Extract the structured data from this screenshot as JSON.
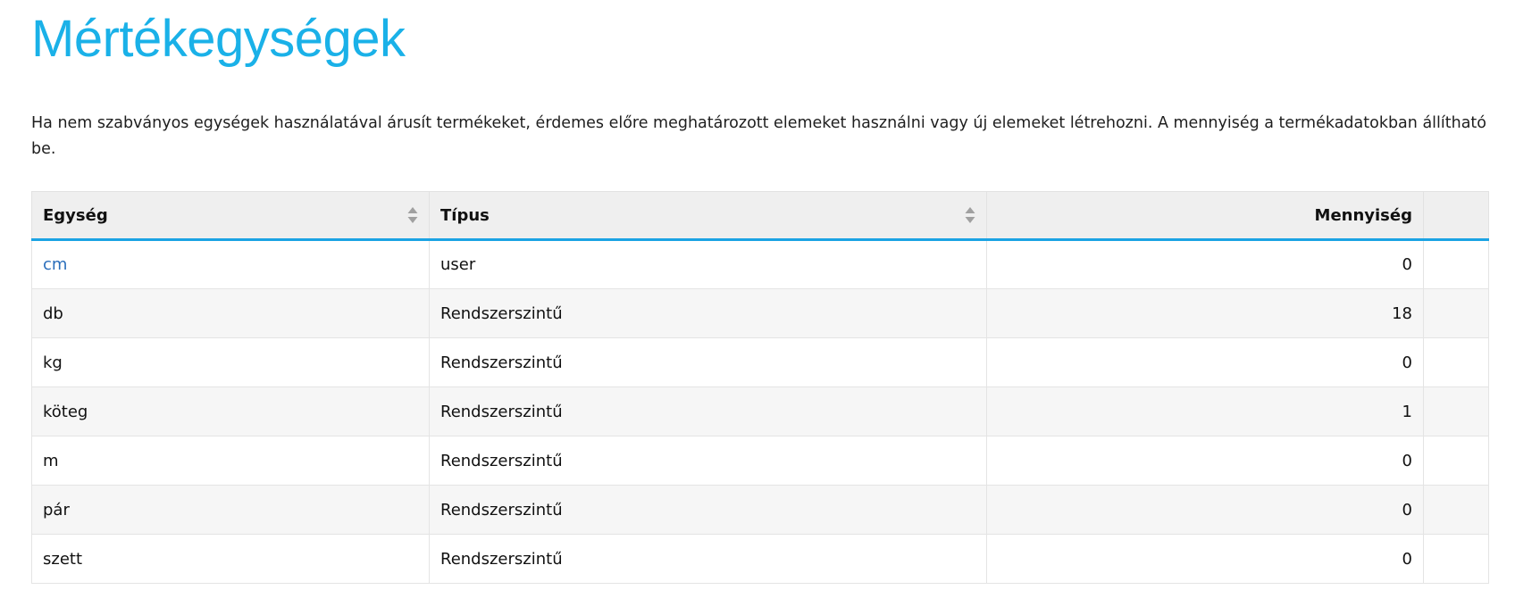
{
  "page": {
    "title": "Mértékegységek",
    "description": "Ha nem szabványos egységek használatával árusít termékeket, érdemes előre meghatározott elemeket használni vagy új elemeket létrehozni. A mennyiség a termékadatokban állítható be."
  },
  "table": {
    "headers": {
      "unit": "Egység",
      "type": "Típus",
      "quantity": "Mennyiség",
      "extra": ""
    },
    "rows": [
      {
        "unit": "cm",
        "type": "user",
        "quantity": "0",
        "link": true
      },
      {
        "unit": "db",
        "type": "Rendszerszintű",
        "quantity": "18",
        "link": false
      },
      {
        "unit": "kg",
        "type": "Rendszerszintű",
        "quantity": "0",
        "link": false
      },
      {
        "unit": "köteg",
        "type": "Rendszerszintű",
        "quantity": "1",
        "link": false
      },
      {
        "unit": "m",
        "type": "Rendszerszintű",
        "quantity": "0",
        "link": false
      },
      {
        "unit": "pár",
        "type": "Rendszerszintű",
        "quantity": "0",
        "link": false
      },
      {
        "unit": "szett",
        "type": "Rendszerszintű",
        "quantity": "0",
        "link": false
      }
    ]
  },
  "icons": {
    "sort": "sort-arrows-icon"
  },
  "colors": {
    "title": "#1ab1e8",
    "header_underline": "#1ba3e3",
    "link": "#2a6ebb",
    "header_bg": "#efefef",
    "row_alt_bg": "#f6f6f6"
  }
}
